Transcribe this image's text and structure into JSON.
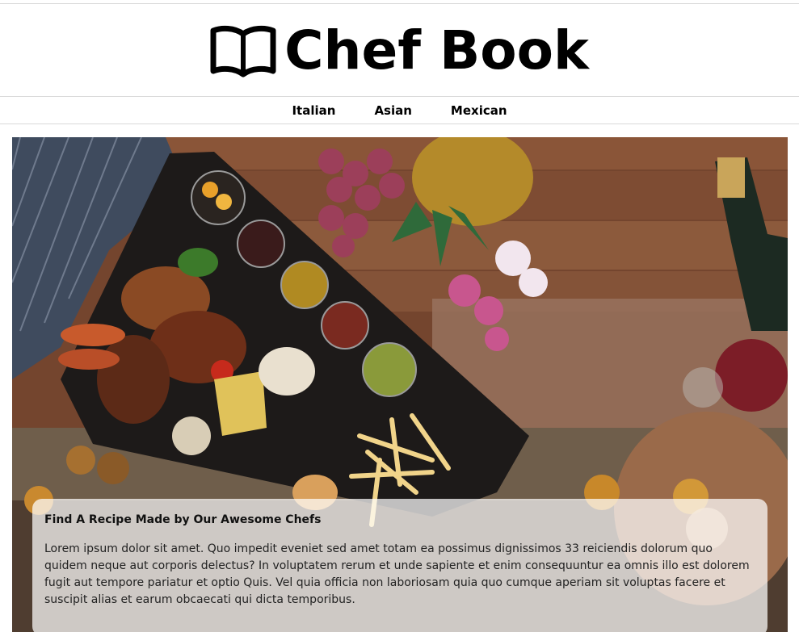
{
  "site": {
    "title": "Chef Book",
    "logo_icon": "open-book-icon"
  },
  "nav": {
    "items": [
      {
        "label": "Italian"
      },
      {
        "label": "Asian"
      },
      {
        "label": "Mexican"
      }
    ]
  },
  "hero": {
    "image_alt": "food-platter-photo",
    "caption_title": "Find A Recipe Made by Our Awesome Chefs",
    "caption_text": "Lorem ipsum dolor sit amet. Quo impedit eveniet sed amet totam ea possimus dignissimos 33 reiciendis dolorum quo quidem neque aut corporis delectus? In voluptatem rerum et unde sapiente et enim consequuntur ea omnis illo est dolorem fugit aut tempore pariatur et optio Quis. Vel quia officia non laboriosam quia quo cumque aperiam sit voluptas facere et suscipit alias et earum obcaecati qui dicta temporibus."
  },
  "colors": {
    "text": "#000000",
    "divider": "#d9d9d9",
    "caption_bg": "rgba(255,255,255,0.72)"
  }
}
